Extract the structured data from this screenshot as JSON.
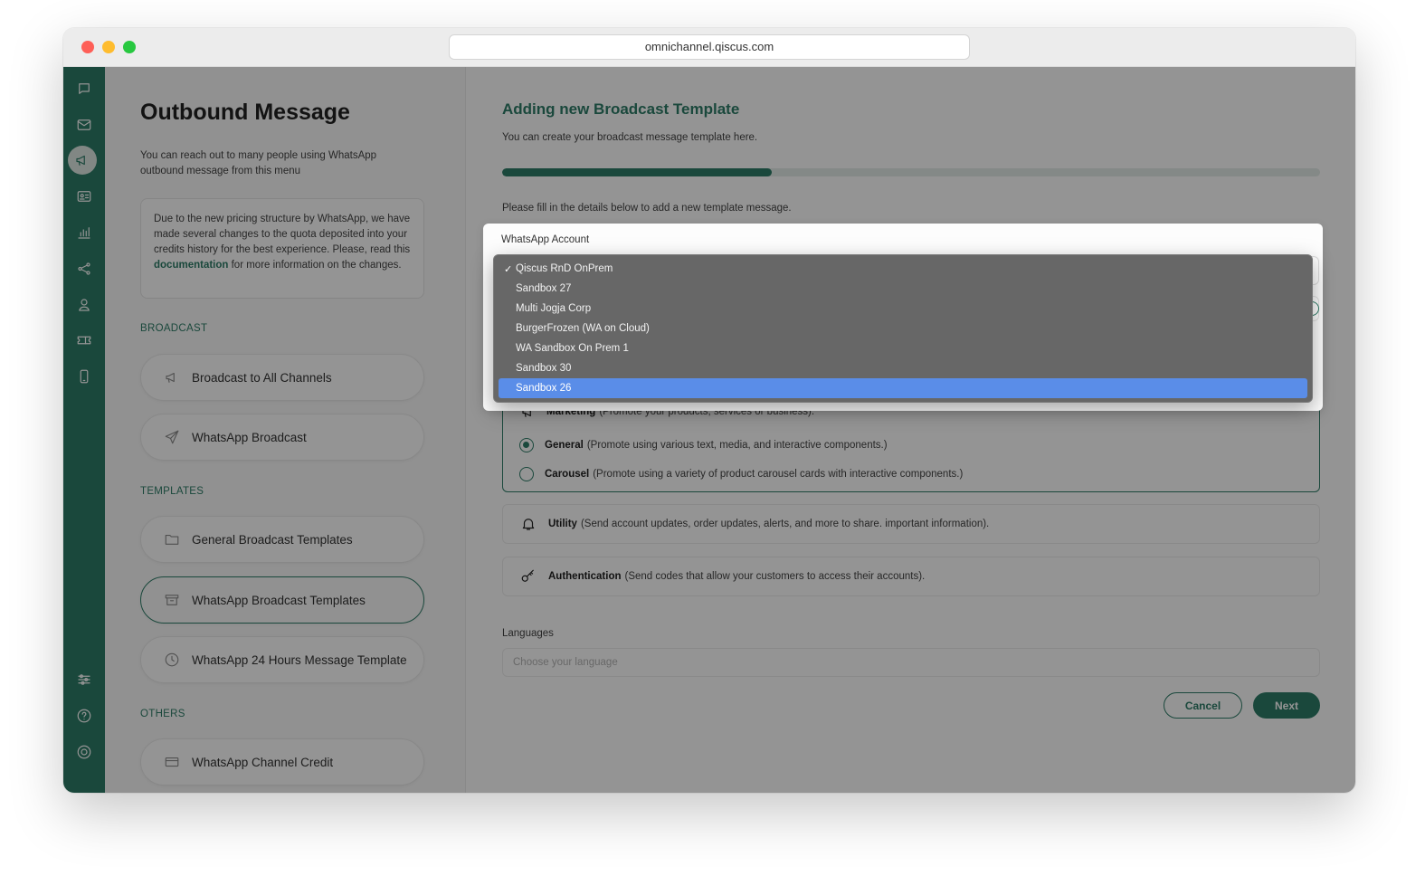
{
  "browser": {
    "url": "omnichannel.qiscus.com"
  },
  "rail": {
    "icons": [
      "chat-icon",
      "inbox-icon",
      "megaphone-icon",
      "contact-card-icon",
      "analytics-icon",
      "integration-icon",
      "agent-icon",
      "ticket-icon",
      "mobile-icon",
      "settings-sliders-icon",
      "help-icon",
      "account-icon"
    ],
    "active": "megaphone-icon"
  },
  "sidebar": {
    "title": "Outbound Message",
    "intro": "You can reach out to many people using WhatsApp outbound message from this menu",
    "notice": {
      "before": "Due to the new pricing structure by WhatsApp, we have made several changes to the quota deposited into your credits history for the best experience. Please, read this ",
      "link": "documentation",
      "after": " for more information on the changes."
    },
    "sections": {
      "broadcast": "BROADCAST",
      "templates": "TEMPLATES",
      "others": "OTHERS"
    },
    "broadcast_items": [
      {
        "label": "Broadcast to All Channels",
        "icon": "megaphone-icon"
      },
      {
        "label": "WhatsApp Broadcast",
        "icon": "send-icon"
      }
    ],
    "template_items": [
      {
        "label": "General Broadcast Templates",
        "icon": "folder-icon"
      },
      {
        "label": "WhatsApp Broadcast Templates",
        "icon": "archive-icon",
        "active": true
      },
      {
        "label": "WhatsApp 24 Hours Message Template",
        "icon": "clock-icon"
      }
    ],
    "other_items": [
      {
        "label": "WhatsApp Channel Credit",
        "icon": "credit-card-icon"
      }
    ]
  },
  "main": {
    "title": "Adding new Broadcast Template",
    "subtitle": "You can create your broadcast message template here.",
    "progress": 0.33,
    "fill_in": "Please fill in the details below to add a new template message.",
    "whatsapp_account": {
      "label": "WhatsApp Account",
      "options": [
        "Qiscus RnD OnPrem",
        "Sandbox 27",
        "Multi Jogja Corp",
        "BurgerFrozen (WA on Cloud)",
        "WA Sandbox On Prem 1",
        "Sandbox 30",
        "Sandbox 26"
      ],
      "checked": "Qiscus RnD OnPrem",
      "highlighted": "Sandbox 26"
    },
    "categories": {
      "marketing": {
        "title": "Marketing",
        "desc": "(Promote your products, services or business).",
        "icon": "megaphone-icon"
      },
      "general": {
        "title": "General",
        "desc": "(Promote using various text, media, and interactive components.)",
        "selected": true
      },
      "carousel": {
        "title": "Carousel",
        "desc": "(Promote using a variety of product carousel cards with interactive components.)",
        "selected": false
      },
      "utility": {
        "title": "Utility",
        "desc": "(Send account updates, order updates, alerts, and more to share. important information).",
        "icon": "bell-icon"
      },
      "authentication": {
        "title": "Authentication",
        "desc": "(Send codes that allow your customers to access their accounts).",
        "icon": "key-icon"
      }
    },
    "languages": {
      "label": "Languages",
      "placeholder": "Choose your language"
    },
    "buttons": {
      "cancel": "Cancel",
      "next": "Next"
    }
  },
  "colors": {
    "brand": "#2e7d68",
    "dropdown_bg": "#676767",
    "dropdown_highlight": "#5a8de8"
  }
}
